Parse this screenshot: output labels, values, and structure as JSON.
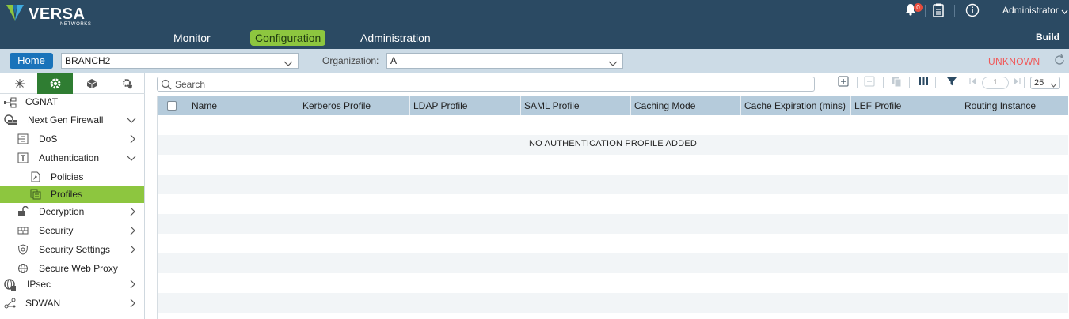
{
  "header": {
    "brand": "VERSA",
    "brand_sub": "NETWORKS",
    "nav": {
      "monitor": "Monitor",
      "configuration": "Configuration",
      "administration": "Administration"
    },
    "build": "Build",
    "notification_count": "0",
    "user": "Administrator"
  },
  "context": {
    "home": "Home",
    "appliance": "BRANCH2",
    "organization_label": "Organization:",
    "organization": "A",
    "status": "UNKNOWN"
  },
  "sidebar": {
    "items": [
      {
        "label": "CGNAT"
      },
      {
        "label": "Next Gen Firewall"
      },
      {
        "label": "DoS"
      },
      {
        "label": "Authentication"
      },
      {
        "label": "Policies"
      },
      {
        "label": "Profiles"
      },
      {
        "label": "Decryption"
      },
      {
        "label": "Security"
      },
      {
        "label": "Security Settings"
      },
      {
        "label": "Secure Web Proxy"
      },
      {
        "label": "IPsec"
      },
      {
        "label": "SDWAN"
      }
    ]
  },
  "main": {
    "search_placeholder": "Search",
    "page_number": "1",
    "page_size": "25",
    "columns": [
      "Name",
      "Kerberos Profile",
      "LDAP Profile",
      "SAML Profile",
      "Caching Mode",
      "Cache Expiration (mins)",
      "LEF Profile",
      "Routing Instance"
    ],
    "empty_message": "NO AUTHENTICATION PROFILE ADDED"
  },
  "colors": {
    "header_bg": "#2b4a63",
    "accent_green": "#8dc63f",
    "home_blue": "#1a73ba",
    "status_red": "#f05a5a",
    "grid_header": "#b5cbdb"
  }
}
